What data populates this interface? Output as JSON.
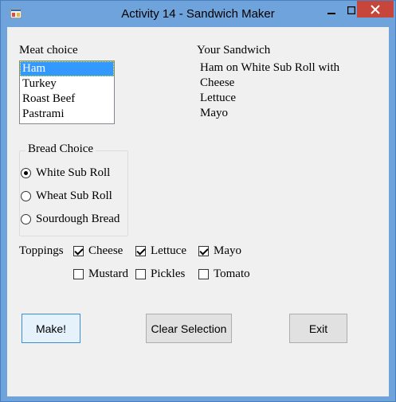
{
  "window": {
    "title": "Activity 14 - Sandwich Maker",
    "accent_color": "#6fa3dc",
    "close_color": "#c7463b"
  },
  "meat": {
    "label": "Meat choice",
    "options": [
      "Ham",
      "Turkey",
      "Roast Beef",
      "Pastrami"
    ],
    "selected": "Ham"
  },
  "sandwich": {
    "label": "Your Sandwich",
    "lines": [
      "Ham on White Sub Roll with",
      "Cheese",
      "Lettuce",
      "Mayo"
    ]
  },
  "bread": {
    "label": "Bread Choice",
    "options": [
      {
        "label": "White Sub Roll",
        "checked": true
      },
      {
        "label": "Wheat Sub Roll",
        "checked": false
      },
      {
        "label": "Sourdough Bread",
        "checked": false
      }
    ]
  },
  "toppings": {
    "label": "Toppings",
    "items": [
      {
        "label": "Cheese",
        "checked": true
      },
      {
        "label": "Lettuce",
        "checked": true
      },
      {
        "label": "Mayo",
        "checked": true
      },
      {
        "label": "Mustard",
        "checked": false
      },
      {
        "label": "Pickles",
        "checked": false
      },
      {
        "label": "Tomato",
        "checked": false
      }
    ]
  },
  "buttons": {
    "make": "Make!",
    "clear": "Clear Selection",
    "exit": "Exit"
  },
  "icons": {
    "app": "app-icon",
    "minimize": "minimize-icon",
    "maximize": "maximize-icon",
    "close": "close-icon"
  }
}
